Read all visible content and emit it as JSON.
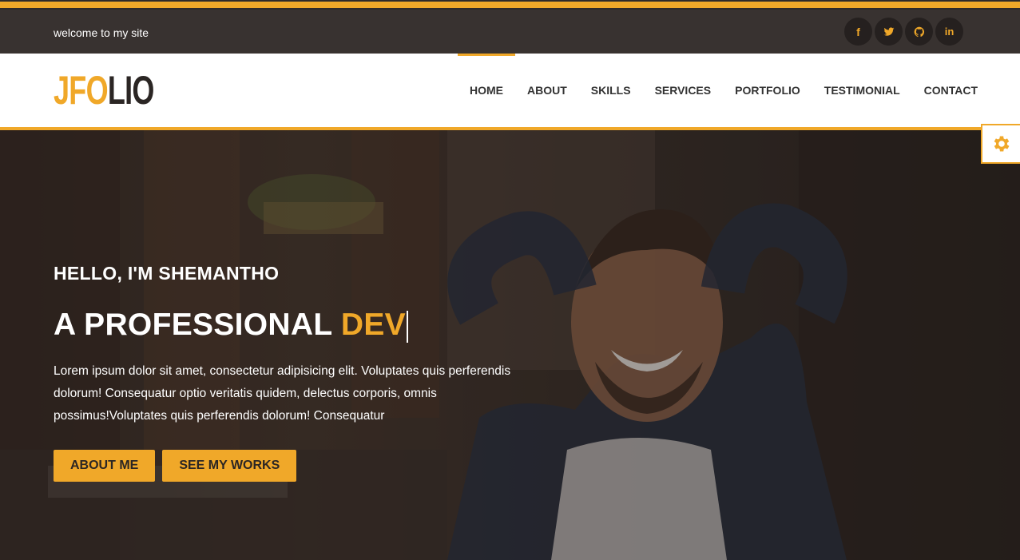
{
  "topbar": {
    "welcome": "welcome to my site",
    "socials": [
      {
        "icon": "facebook-icon",
        "glyph": "f"
      },
      {
        "icon": "twitter-icon"
      },
      {
        "icon": "github-icon"
      },
      {
        "icon": "linkedin-icon",
        "glyph": "in"
      }
    ]
  },
  "logo": {
    "part1": "JFO",
    "part2": "LIO"
  },
  "nav": {
    "items": [
      "HOME",
      "ABOUT",
      "SKILLS",
      "SERVICES",
      "PORTFOLIO",
      "TESTIMONIAL",
      "CONTACT"
    ],
    "active": "HOME"
  },
  "settings": {
    "icon": "gear-icon"
  },
  "hero": {
    "greeting": "HELLO, I'M SHEMANTHO",
    "headline_static": "A PROFESSIONAL ",
    "headline_typed": "DEV",
    "description": "Lorem ipsum dolor sit amet, consectetur adipisicing elit. Voluptates quis perferendis dolorum! Consequatur optio veritatis quidem, delectus corporis, omnis possimus!Voluptates quis perferendis dolorum! Consequatur",
    "buttons": [
      "ABOUT ME",
      "SEE MY WORKS"
    ]
  },
  "colors": {
    "accent": "#f0a829",
    "dark": "#383230",
    "text_dark": "#333333"
  }
}
